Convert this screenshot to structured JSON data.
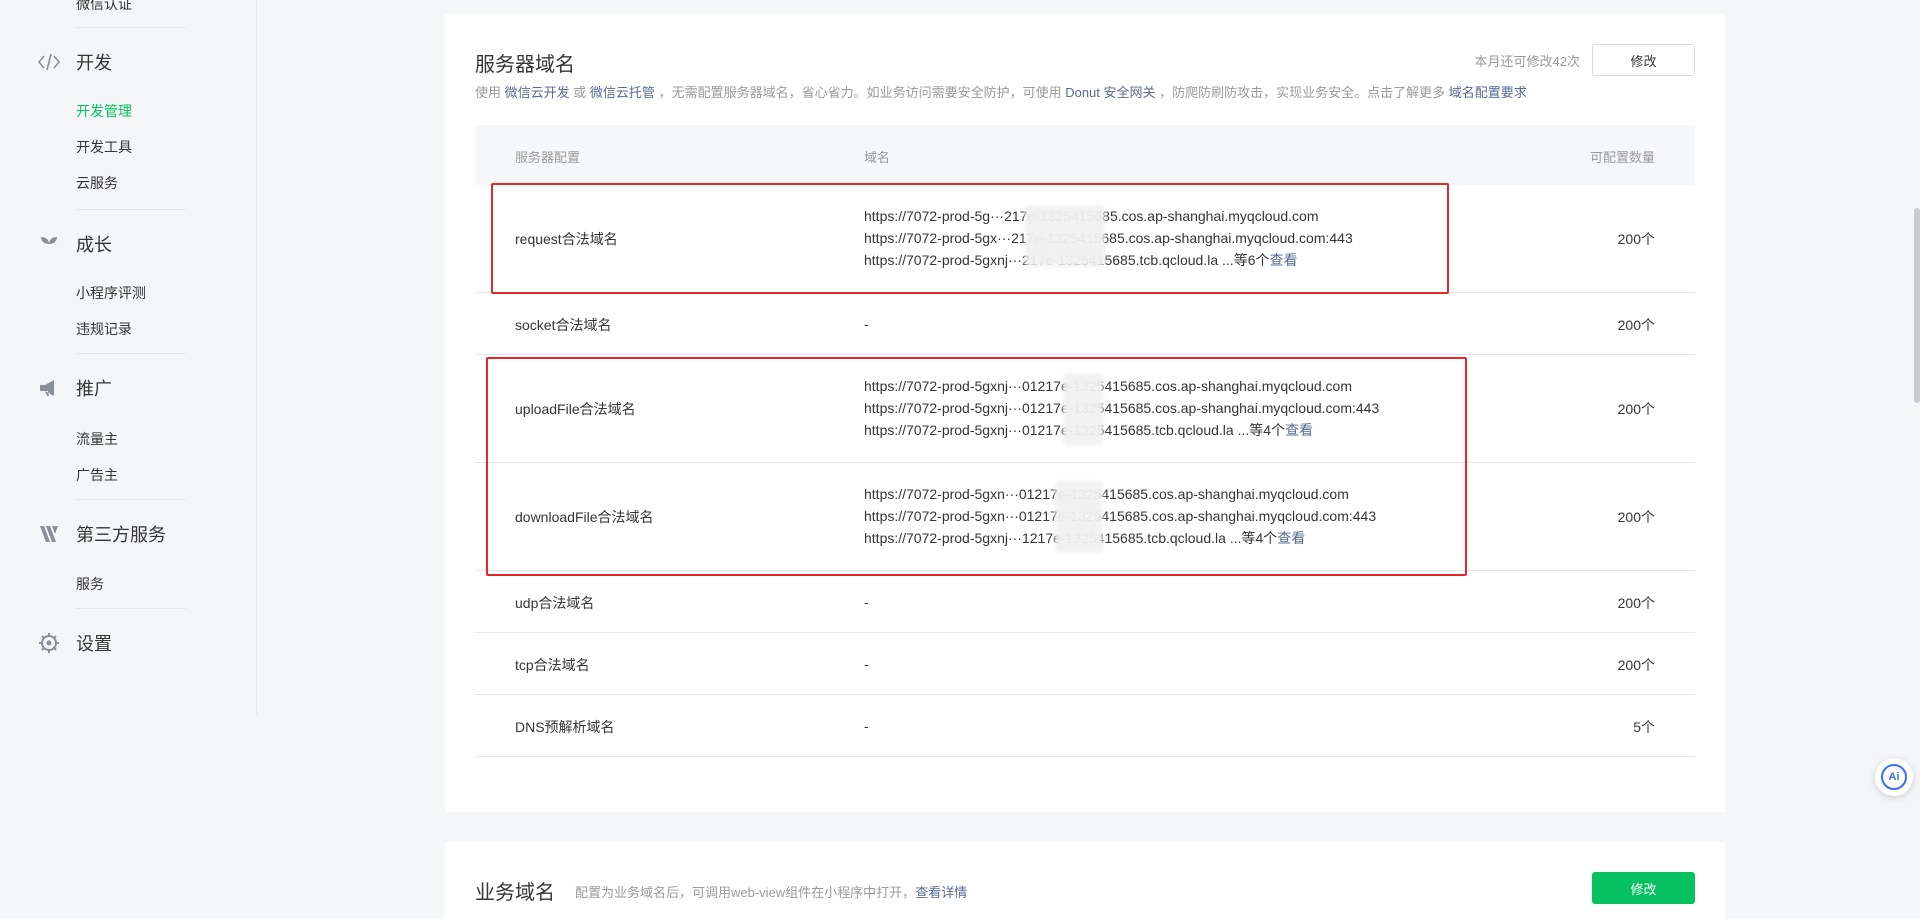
{
  "sidebar": {
    "top_partial": "微信认证",
    "groups": [
      {
        "title": "开发",
        "icon": "code-icon",
        "items": [
          "开发管理",
          "开发工具",
          "云服务"
        ],
        "active": "开发管理"
      },
      {
        "title": "成长",
        "icon": "sprout-icon",
        "items": [
          "小程序评测",
          "违规记录"
        ]
      },
      {
        "title": "推广",
        "icon": "megaphone-icon",
        "items": [
          "流量主",
          "广告主"
        ]
      },
      {
        "title": "第三方服务",
        "icon": "x-icon",
        "items": [
          "服务"
        ]
      },
      {
        "title": "设置",
        "icon": "gear-icon",
        "items": []
      }
    ]
  },
  "server_domain": {
    "title": "服务器域名",
    "modify_hint": "本月还可修改42次",
    "modify_button": "修改",
    "desc": {
      "p1": "使用",
      "l1": "微信云开发",
      "p2": "或",
      "l2": "微信云托管",
      "p3": "，无需配置服务器域名，省心省力。如业务访问需要安全防护，可使用",
      "l3": "Donut 安全网关",
      "p4": "，防爬防刷防攻击，实现业务安全。点击了解更多",
      "l4": "域名配置要求"
    },
    "headers": {
      "config": "服务器配置",
      "domain": "域名",
      "count": "可配置数量"
    },
    "rows": [
      {
        "name": "request合法域名",
        "domains": [
          "https://7072-prod-5g···217e-1325415685.cos.ap-shanghai.myqcloud.com",
          "https://7072-prod-5gx···217e-1325415685.cos.ap-shanghai.myqcloud.com:443",
          "https://7072-prod-5gxnj···217e-1325415685.tcb.qcloud.la"
        ],
        "more": "...等6个",
        "view": "查看",
        "count": "200个"
      },
      {
        "name": "socket合法域名",
        "domains": [
          "-"
        ],
        "count": "200个"
      },
      {
        "name": "uploadFile合法域名",
        "domains": [
          "https://7072-prod-5gxnj···01217e-1325415685.cos.ap-shanghai.myqcloud.com",
          "https://7072-prod-5gxnj···01217e-1325415685.cos.ap-shanghai.myqcloud.com:443",
          "https://7072-prod-5gxnj···01217e-1325415685.tcb.qcloud.la"
        ],
        "more": "...等4个",
        "view": "查看",
        "count": "200个"
      },
      {
        "name": "downloadFile合法域名",
        "domains": [
          "https://7072-prod-5gxn···01217e-1325415685.cos.ap-shanghai.myqcloud.com",
          "https://7072-prod-5gxn···01217e-1325415685.cos.ap-shanghai.myqcloud.com:443",
          "https://7072-prod-5gxnj···1217e-1325415685.tcb.qcloud.la"
        ],
        "more": "...等4个",
        "view": "查看",
        "count": "200个"
      },
      {
        "name": "udp合法域名",
        "domains": [
          "-"
        ],
        "count": "200个"
      },
      {
        "name": "tcp合法域名",
        "domains": [
          "-"
        ],
        "count": "200个"
      },
      {
        "name": "DNS预解析域名",
        "domains": [
          "-"
        ],
        "count": "5个"
      }
    ]
  },
  "business_domain": {
    "title": "业务域名",
    "desc": "配置为业务域名后，可调用web-view组件在小程序中打开，",
    "desc_link": "查看详情",
    "button": "修改"
  },
  "ai_badge": "Ai",
  "colors": {
    "accent_green": "#07c160",
    "link_blue": "#576b95",
    "highlight_red": "#e5262a"
  }
}
